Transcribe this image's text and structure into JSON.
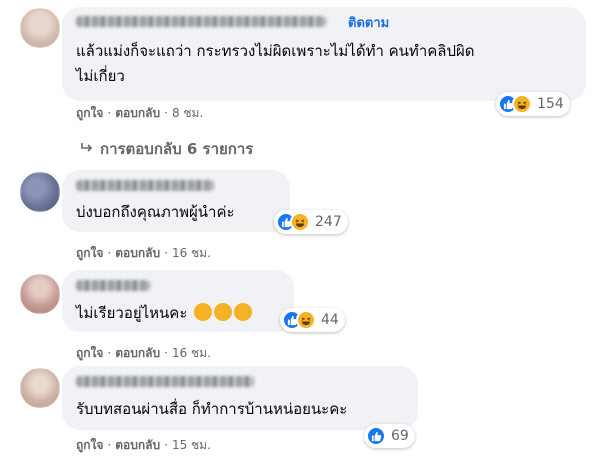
{
  "comments": [
    {
      "follow_label": "ติดตาม",
      "text_line1": "แล้วแม่งก็จะแถว่า กระทรวงไม่ผิดเพราะไม่ได้ทำ คนทำคลิปผิด",
      "text_line2": "ไม่เกี่ยว",
      "like_label": "ถูกใจ",
      "reply_label": "ตอบกลับ",
      "time": "8 ชม.",
      "reaction_count": "154",
      "view_replies": "การตอบกลับ 6 รายการ"
    },
    {
      "text_line1": "บ่งบอกถึงคุณภาพผู้นำค่ะ",
      "like_label": "ถูกใจ",
      "reply_label": "ตอบกลับ",
      "time": "16 ชม.",
      "reaction_count": "247"
    },
    {
      "text_line1": "ไม่เรียวอยู่ไหนคะ",
      "like_label": "ถูกใจ",
      "reply_label": "ตอบกลับ",
      "time": "16 ชม.",
      "reaction_count": "44"
    },
    {
      "text_line1": "รับบทสอนผ่านสื่อ ก็ทำการบ้านหน่อยนะคะ",
      "like_label": "ถูกใจ",
      "reply_label": "ตอบกลับ",
      "time": "15 ชม.",
      "reaction_count": "69"
    }
  ],
  "colors": {
    "bubble": "#f0f2f5",
    "follow": "#216fdb",
    "meta": "#65676b",
    "like": "#1877f2",
    "haha": "#f7b125"
  },
  "icons": [
    "like-icon",
    "haha-icon",
    "reply-arrow-icon",
    "laugh-cry-emoji"
  ]
}
